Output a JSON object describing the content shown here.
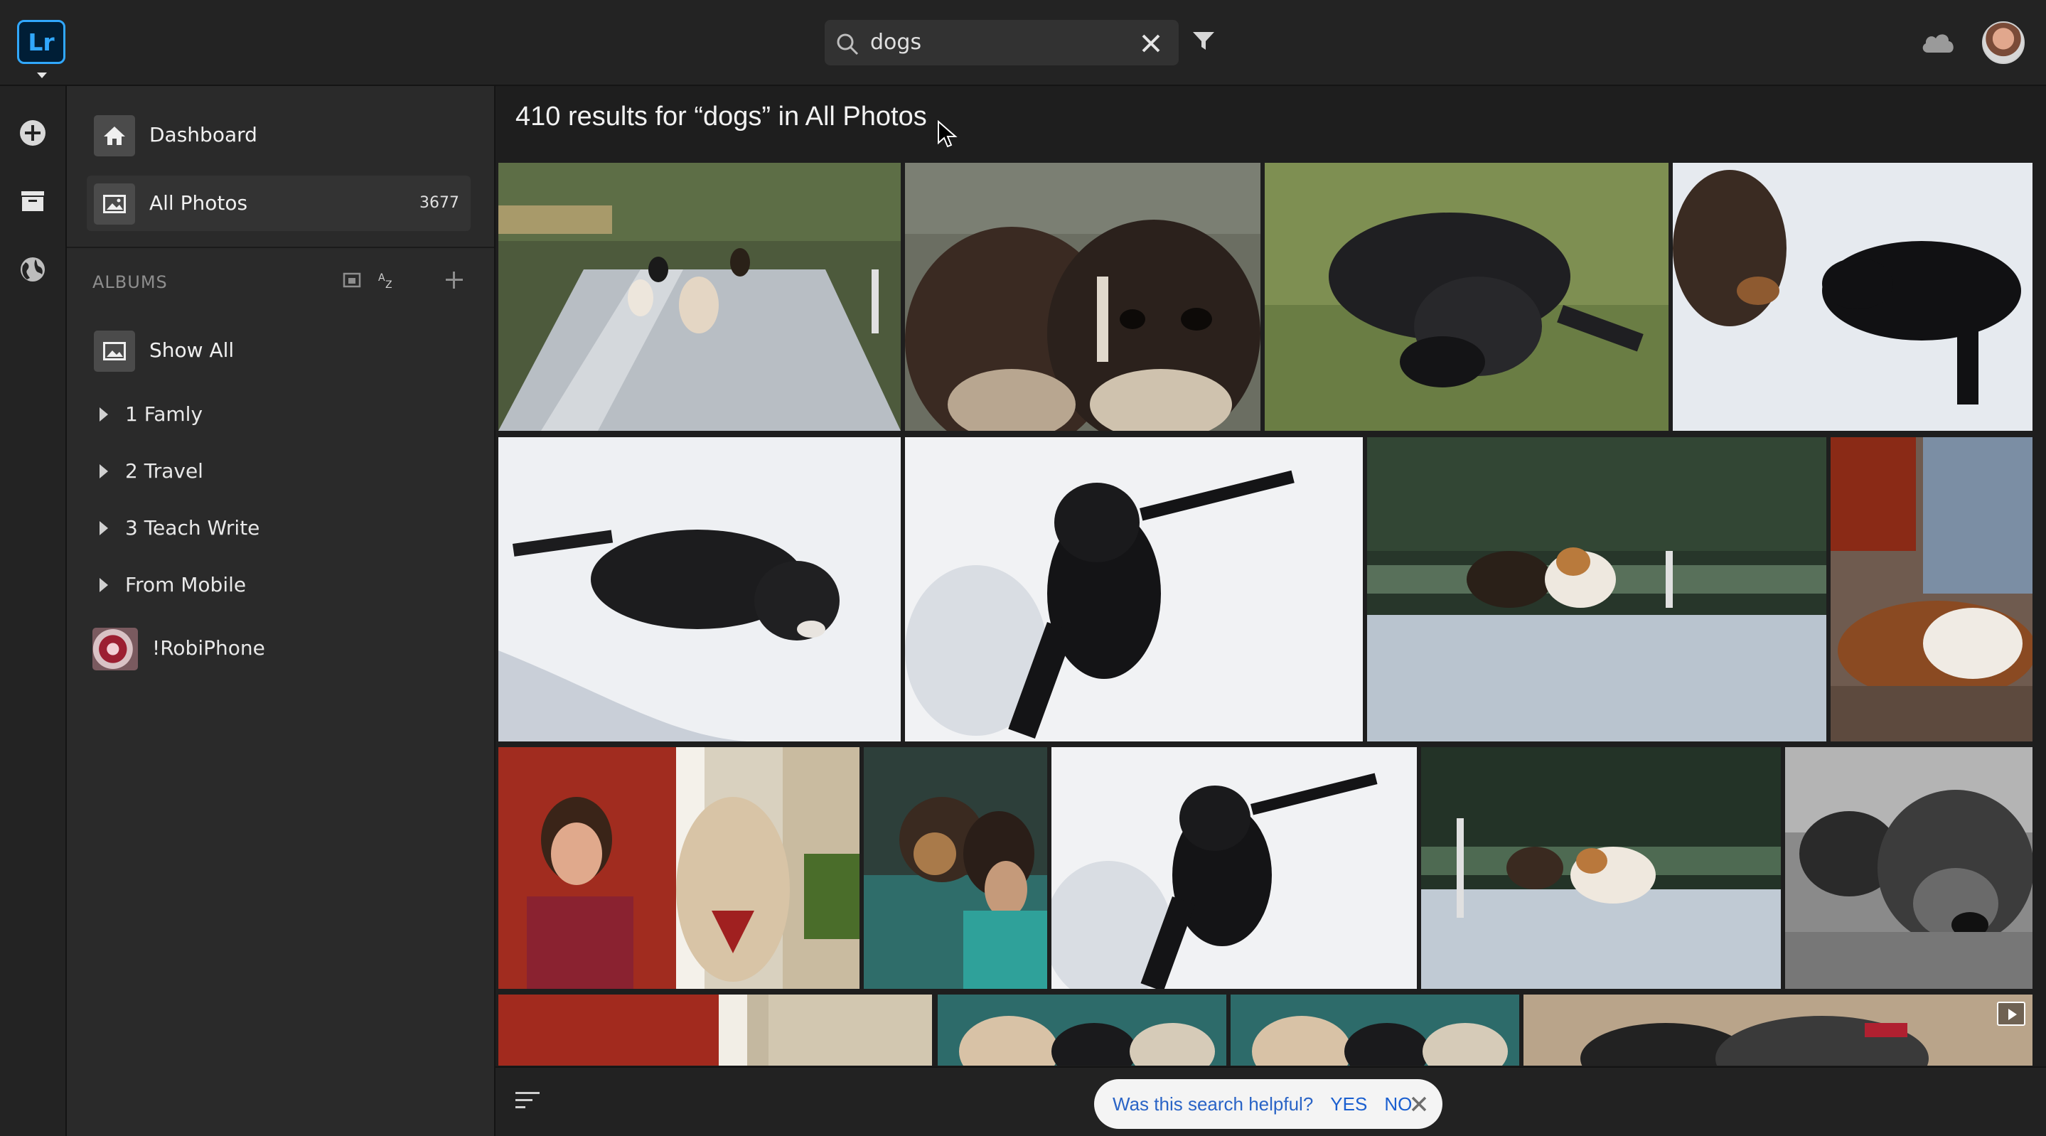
{
  "app": {
    "logo_text": "Lr",
    "accent": "#31a8ff"
  },
  "search": {
    "query": "dogs"
  },
  "header": {
    "icons": [
      "search-icon",
      "clear-icon",
      "filter-icon",
      "cloud-icon",
      "avatar"
    ]
  },
  "rail": {
    "icons": [
      "add-icon",
      "library-icon",
      "globe-icon"
    ]
  },
  "sidebar": {
    "nav": [
      {
        "label": "Dashboard",
        "icon": "home-icon"
      },
      {
        "label": "All Photos",
        "icon": "photo-icon",
        "count": "3677"
      }
    ],
    "albums_header": "ALBUMS",
    "albums": [
      {
        "label": "Show All"
      },
      {
        "label": "1 Famly"
      },
      {
        "label": "2 Travel"
      },
      {
        "label": "3 Teach Write"
      },
      {
        "label": "From Mobile"
      },
      {
        "label": "!RobiPhone"
      }
    ]
  },
  "main": {
    "results_title": "410 results for “dogs” in All Photos"
  },
  "feedback": {
    "question": "Was this search helpful?",
    "yes": "YES",
    "no": "NO"
  }
}
